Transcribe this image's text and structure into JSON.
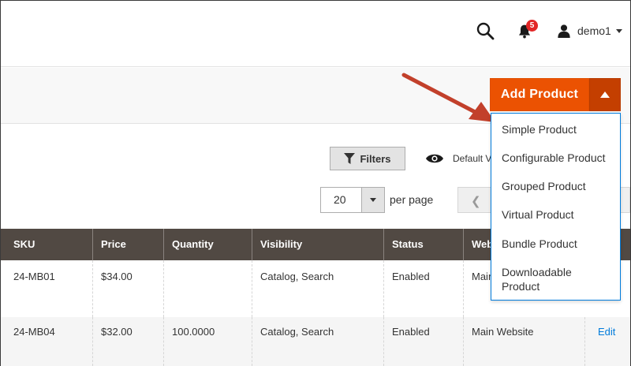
{
  "header": {
    "notifications_count": "5",
    "username": "demo1",
    "icons": [
      "search-icon",
      "bell-icon",
      "user-icon",
      "chevron-down-icon"
    ]
  },
  "actions": {
    "add_product_label": "Add Product",
    "accent_color": "#eb5202",
    "toggle_color": "#c43f00"
  },
  "add_menu": {
    "items": [
      {
        "label": "Simple Product"
      },
      {
        "label": "Configurable Product"
      },
      {
        "label": "Grouped Product"
      },
      {
        "label": "Virtual Product"
      },
      {
        "label": "Bundle Product"
      },
      {
        "label": "Downloadable Product",
        "lines": [
          "Downloadable",
          "Product"
        ]
      }
    ]
  },
  "toolbar": {
    "filters_label": "Filters",
    "view_label": "Default V",
    "per_page_value": "20",
    "per_page_label": "per page"
  },
  "grid": {
    "columns": [
      "SKU",
      "Price",
      "Quantity",
      "Visibility",
      "Status",
      "Web"
    ],
    "rows": [
      {
        "sku": "24-MB01",
        "price": "$34.00",
        "quantity": "",
        "visibility": "Catalog, Search",
        "status": "Enabled",
        "website": "Main",
        "action": ""
      },
      {
        "sku": "24-MB04",
        "price": "$32.00",
        "quantity": "100.0000",
        "visibility": "Catalog, Search",
        "status": "Enabled",
        "website": "Main Website",
        "action": "Edit"
      }
    ],
    "header_color": "#514943"
  }
}
